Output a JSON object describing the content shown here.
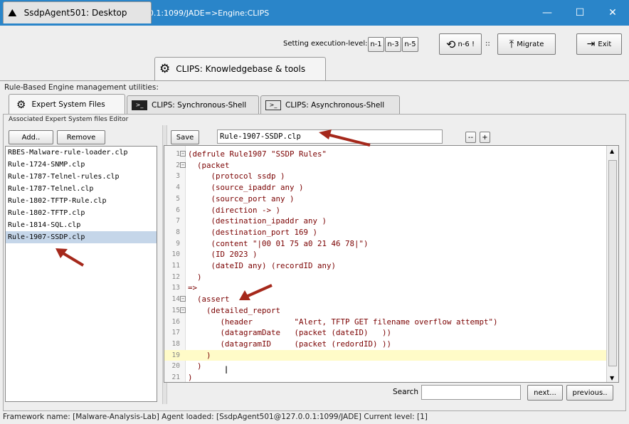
{
  "window": {
    "title": "On Stage:SsdpAgent501@127.0.0.1:1099/JADE=>Engine:CLIPS",
    "minimize": "—",
    "maximize": "☐",
    "close": "✕"
  },
  "toolbar": {
    "level_label": "Setting execution-level:",
    "levels": [
      "n-1",
      "n-3",
      "n-5"
    ],
    "n6_label": "n-6 !",
    "sep": "::",
    "migrate_label": "Migrate",
    "exit_label": "Exit"
  },
  "outer_tabs": [
    {
      "label": "SsdpAgent501: Desktop",
      "icon": "cloud-icon"
    },
    {
      "label": "CLIPS: Knowledgebase & tools",
      "icon": "gear-icon"
    }
  ],
  "utilities_label": "Rule-Based Engine management utilities:",
  "inner_tabs": [
    {
      "label": "Expert System Files",
      "icon": "gears-icon"
    },
    {
      "label": "CLIPS: Synchronous-Shell",
      "icon": "terminal-icon"
    },
    {
      "label": "CLIPS: Asynchronous-Shell",
      "icon": "terminal-icon"
    }
  ],
  "group_title": "Associated Expert System files Editor",
  "file_panel": {
    "add_label": "Add..",
    "remove_label": "Remove",
    "files": [
      "RBES-Malware-rule-loader.clp",
      "Rule-1724-SNMP.clp",
      "Rule-1787-Telnel-rules.clp",
      "Rule-1787-Telnel.clp",
      "Rule-1802-TFTP-Rule.clp",
      "Rule-1802-TFTP.clp",
      "Rule-1814-SQL.clp",
      "Rule-1907-SSDP.clp"
    ],
    "selected": "Rule-1907-SSDP.clp"
  },
  "editor": {
    "save_label": "Save",
    "filename": "Rule-1907-SSDP.clp",
    "zoom_out": "--",
    "zoom_in": "+",
    "lines": [
      {
        "n": "1",
        "fold": "−",
        "t": "(defrule Rule1907 \"SSDP Rules\""
      },
      {
        "n": "2",
        "fold": "−",
        "t": "  (packet"
      },
      {
        "n": "3",
        "fold": "",
        "t": "     (protocol ssdp )"
      },
      {
        "n": "4",
        "fold": "",
        "t": "     (source_ipaddr any )"
      },
      {
        "n": "5",
        "fold": "",
        "t": "     (source_port any )"
      },
      {
        "n": "6",
        "fold": "",
        "t": "     (direction -> )"
      },
      {
        "n": "7",
        "fold": "",
        "t": "     (destination_ipaddr any )"
      },
      {
        "n": "8",
        "fold": "",
        "t": "     (destination_port 169 )"
      },
      {
        "n": "9",
        "fold": "",
        "t": "     (content \"|00 01 75 a0 21 46 78|\")"
      },
      {
        "n": "10",
        "fold": "",
        "t": "     (ID 2023 )"
      },
      {
        "n": "11",
        "fold": "",
        "t": "     (dateID any) (recordID any)"
      },
      {
        "n": "12",
        "fold": "",
        "t": "  )"
      },
      {
        "n": "13",
        "fold": "",
        "t": "=>"
      },
      {
        "n": "14",
        "fold": "−",
        "t": "  (assert"
      },
      {
        "n": "15",
        "fold": "−",
        "t": "    (detailed_report"
      },
      {
        "n": "16",
        "fold": "",
        "t": "       (header         \"Alert, TFTP GET filename overflow attempt\")"
      },
      {
        "n": "17",
        "fold": "",
        "t": "       (datagramDate   (packet (dateID)   ))"
      },
      {
        "n": "18",
        "fold": "",
        "t": "       (datagramID     (packet (redordID) ))"
      },
      {
        "n": "19",
        "fold": "",
        "t": "    )"
      },
      {
        "n": "20",
        "fold": "",
        "t": "  )"
      },
      {
        "n": "21",
        "fold": "",
        "t": ")"
      }
    ],
    "highlight_line": 19
  },
  "search": {
    "label": "Search",
    "value": "",
    "next_label": "next...",
    "previous_label": "previous.."
  },
  "status": "Framework name: [Malware-Analysis-Lab] Agent loaded: [SsdpAgent501@127.0.0.1:1099/JADE] Current level: [1]",
  "colors": {
    "titlebar": "#2a85c9",
    "selection": "#c5d6e9",
    "highlight_line": "#fffbc8",
    "annotation_arrow": "#a5281b"
  }
}
